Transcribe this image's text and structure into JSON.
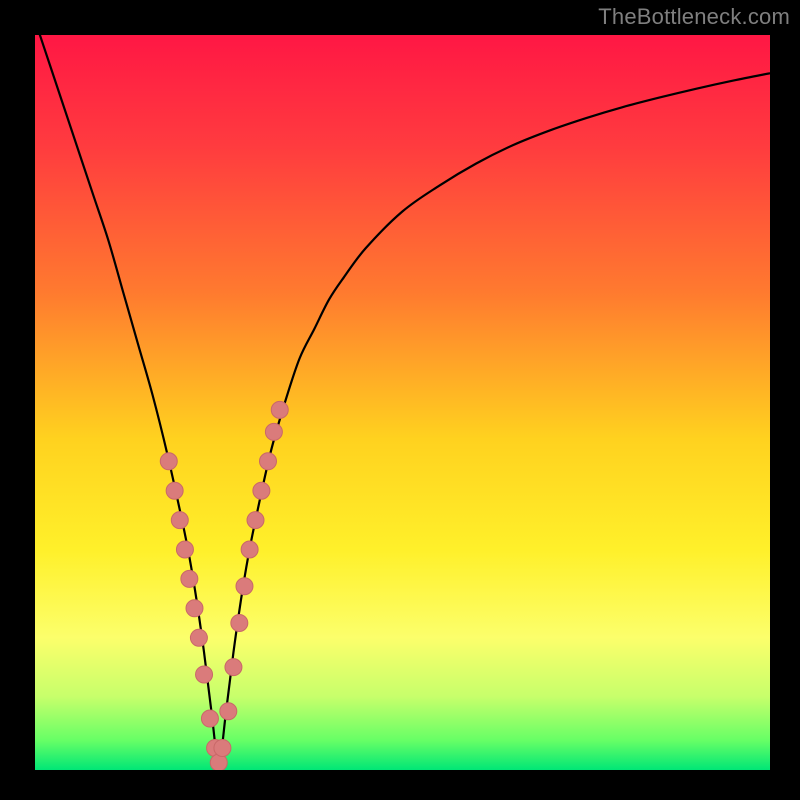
{
  "watermark": "TheBottleneck.com",
  "colors": {
    "frame": "#000000",
    "curve": "#000000",
    "marker_fill": "#da7b7b",
    "marker_stroke": "#c96868",
    "gradient_stops": [
      {
        "offset": 0.0,
        "color": "#ff1744"
      },
      {
        "offset": 0.15,
        "color": "#ff3b3f"
      },
      {
        "offset": 0.35,
        "color": "#ff7a2f"
      },
      {
        "offset": 0.55,
        "color": "#ffd21f"
      },
      {
        "offset": 0.7,
        "color": "#fff02a"
      },
      {
        "offset": 0.82,
        "color": "#fcff6b"
      },
      {
        "offset": 0.9,
        "color": "#c7ff6b"
      },
      {
        "offset": 0.96,
        "color": "#66ff66"
      },
      {
        "offset": 1.0,
        "color": "#00e676"
      }
    ]
  },
  "chart_data": {
    "type": "line",
    "title": "",
    "xlabel": "",
    "ylabel": "",
    "xlim": [
      0,
      100
    ],
    "ylim": [
      0,
      100
    ],
    "series": [
      {
        "name": "bottleneck-curve",
        "x": [
          0,
          2,
          4,
          6,
          8,
          10,
          12,
          14,
          16,
          18,
          20,
          21,
          22,
          23,
          24,
          25,
          26,
          27,
          28,
          29,
          30,
          32,
          34,
          36,
          38,
          40,
          42,
          45,
          50,
          55,
          60,
          65,
          70,
          75,
          80,
          85,
          90,
          95,
          100
        ],
        "values": [
          102,
          96,
          90,
          84,
          78,
          72,
          65,
          58,
          51,
          43,
          34,
          29,
          23,
          16,
          8,
          1,
          8,
          16,
          23,
          29,
          34,
          43,
          50,
          56,
          60,
          64,
          67,
          71,
          76,
          79.5,
          82.5,
          85,
          87,
          88.7,
          90.2,
          91.5,
          92.7,
          93.8,
          94.8
        ]
      }
    ],
    "markers": {
      "name": "highlighted-points",
      "x": [
        18.2,
        19.0,
        19.7,
        20.4,
        21.0,
        21.7,
        22.3,
        23.0,
        23.8,
        24.5,
        25.0,
        25.5,
        26.3,
        27.0,
        27.8,
        28.5,
        29.2,
        30.0,
        30.8,
        31.7,
        32.5,
        33.3
      ],
      "values": [
        42,
        38,
        34,
        30,
        26,
        22,
        18,
        13,
        7,
        3,
        1,
        3,
        8,
        14,
        20,
        25,
        30,
        34,
        38,
        42,
        46,
        49
      ]
    }
  }
}
